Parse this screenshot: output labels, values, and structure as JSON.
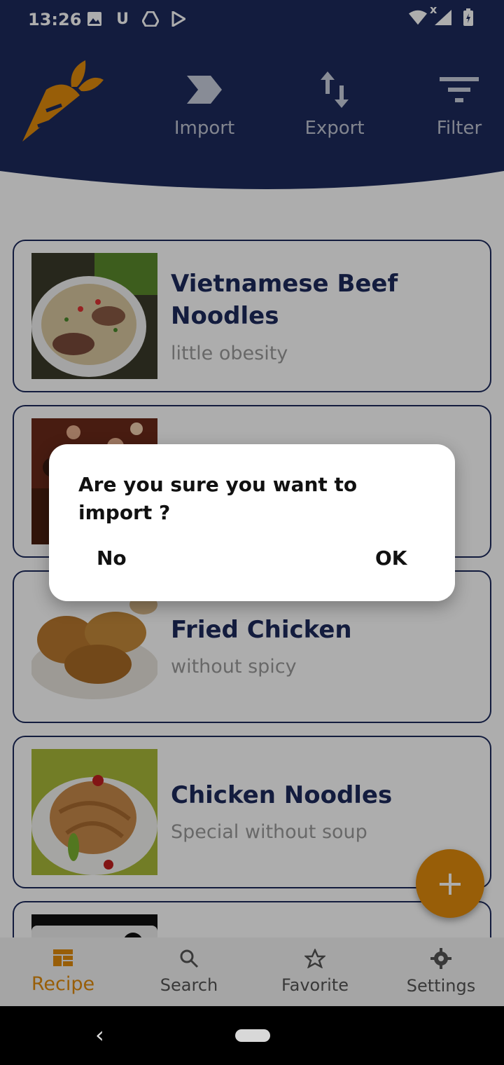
{
  "status_bar": {
    "time": "13:26",
    "left_icons": [
      "image-icon",
      "u-icon",
      "drive-icon",
      "play-store-icon"
    ],
    "right_icons": [
      "wifi-icon",
      "signal-icon",
      "battery-icon"
    ],
    "u_glyph": "U",
    "signal_x": "x"
  },
  "header": {
    "actions": [
      {
        "label": "Import",
        "icon": "import-icon"
      },
      {
        "label": "Export",
        "icon": "export-icon"
      },
      {
        "label": "Filter",
        "icon": "filter-icon"
      }
    ]
  },
  "recipes": [
    {
      "title": "Vietnamese Beef Noodles",
      "subtitle": "little obesity"
    },
    {
      "title": "",
      "subtitle": ""
    },
    {
      "title": "Fried Chicken",
      "subtitle": "without spicy"
    },
    {
      "title": "Chicken Noodles",
      "subtitle": "Special without soup"
    }
  ],
  "fab": {
    "label": "+"
  },
  "bottom_nav": [
    {
      "label": "Recipe",
      "icon": "recipe-icon",
      "active": true
    },
    {
      "label": "Search",
      "icon": "search-icon",
      "active": false
    },
    {
      "label": "Favorite",
      "icon": "star-icon",
      "active": false
    },
    {
      "label": "Settings",
      "icon": "gear-icon",
      "active": false
    }
  ],
  "dialog": {
    "message": "Are you sure you want to import ?",
    "negative": "No",
    "positive": "OK"
  },
  "colors": {
    "primary": "#1c2a5c",
    "accent": "#e08b0d"
  }
}
